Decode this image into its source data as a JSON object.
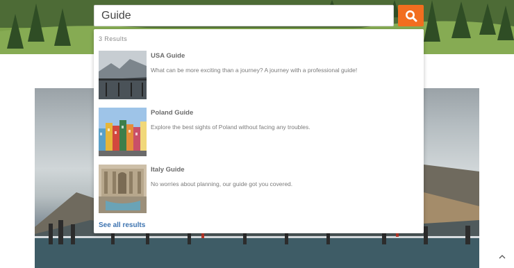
{
  "search": {
    "value": "Guide",
    "button_icon": "search-icon",
    "accent_color": "#f26e1f"
  },
  "results": {
    "count_label": "3 Results",
    "items": [
      {
        "title": "USA Guide",
        "description": "What can be more exciting than a journey? A journey with a professional guide!"
      },
      {
        "title": "Poland Guide",
        "description": "Explore the best sights of Poland without facing any troubles."
      },
      {
        "title": "Italy Guide",
        "description": "No worries about planning, our guide got you covered."
      }
    ],
    "see_all_label": "See all results",
    "link_color": "#3d73b0"
  },
  "page": {
    "scroll_top_icon": "chevron-up-icon"
  }
}
